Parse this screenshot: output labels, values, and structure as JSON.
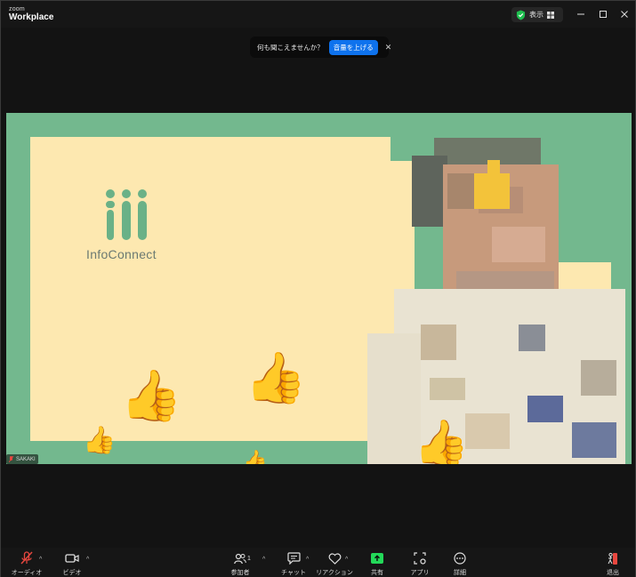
{
  "app": {
    "brand_small": "zoom",
    "brand_large": "Workplace"
  },
  "titlebar": {
    "view_label": "表示"
  },
  "notification": {
    "message": "何も聞こえませんか？",
    "button": "音量を上げる"
  },
  "slide": {
    "logo_text": "InfoConnect"
  },
  "participant": {
    "name": "SAKAKI"
  },
  "toolbar": {
    "audio": "オーディオ",
    "video": "ビデオ",
    "participants": "参加者",
    "participants_count": "1",
    "chat": "チャット",
    "reactions": "リアクション",
    "share": "共有",
    "apps": "アプリ",
    "more": "詳細",
    "leave": "退出"
  },
  "colors": {
    "stage": "#73b88e",
    "slide": "#fde8b0",
    "accent": "#0e72ed",
    "share": "#23d959",
    "muted": "#e8473f"
  }
}
